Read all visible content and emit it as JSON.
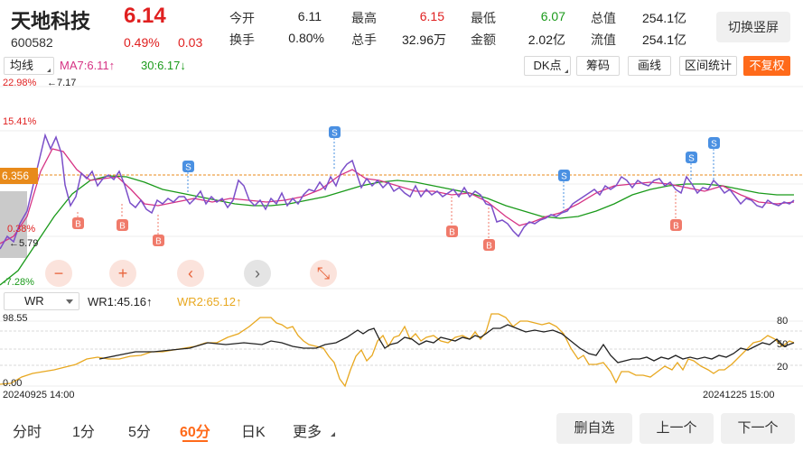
{
  "header": {
    "name": "天地科技",
    "price": "6.14",
    "code": "600582",
    "change_pct": "0.49%",
    "change_abs": "0.03",
    "quotes": [
      {
        "label": "今开",
        "value": "6.11",
        "color": "dark"
      },
      {
        "label": "最高",
        "value": "6.15",
        "color": "red"
      },
      {
        "label": "最低",
        "value": "6.07",
        "color": "green"
      },
      {
        "label": "总值",
        "value": "254.1亿",
        "color": "dark"
      },
      {
        "label": "换手",
        "value": "0.80%",
        "color": "dark"
      },
      {
        "label": "总手",
        "value": "32.96万",
        "color": "dark"
      },
      {
        "label": "金额",
        "value": "2.02亿",
        "color": "dark"
      },
      {
        "label": "流值",
        "value": "254.1亿",
        "color": "dark"
      }
    ],
    "switch_label": "切换竖屏"
  },
  "toolbar": {
    "ma_label": "均线",
    "ma7": "MA7:6.11↑",
    "ma30": "30:6.17↓",
    "tools": [
      "DK点",
      "筹码",
      "画线",
      "区间统计",
      "不复权"
    ]
  },
  "main_chart": {
    "y_top": "22.98%",
    "max_marker": "←7.17",
    "y_upper": "15.41%",
    "current_price_flag": "6.356",
    "y_mid": "0.38%",
    "min_marker": "←5.79",
    "y_bottom": "-7.28%",
    "buy_label": "B",
    "sell_label": "S",
    "colors": {
      "price": "#7b4fc9",
      "ma7": "#d63384",
      "ma30": "#1a9a1a",
      "flag": "#e88a1a",
      "buy": "#f07a6a",
      "sell": "#4a90e2"
    }
  },
  "controls": [
    "−",
    "+",
    "‹",
    "›",
    "⤡"
  ],
  "wr": {
    "label": "WR",
    "wr1": "WR1:45.16↑",
    "wr2": "WR2:65.12↑",
    "y_max": "98.55",
    "y_min": "0.00",
    "right_ticks": [
      "80",
      "50",
      "20"
    ],
    "date_start": "20240925 14:00",
    "date_end": "20241225 15:00"
  },
  "bottom": {
    "periods": [
      "分时",
      "1分",
      "5分",
      "60分",
      "日K",
      "更多"
    ],
    "active_period": "60分",
    "buttons": [
      "删自选",
      "上一个",
      "下一个"
    ]
  }
}
